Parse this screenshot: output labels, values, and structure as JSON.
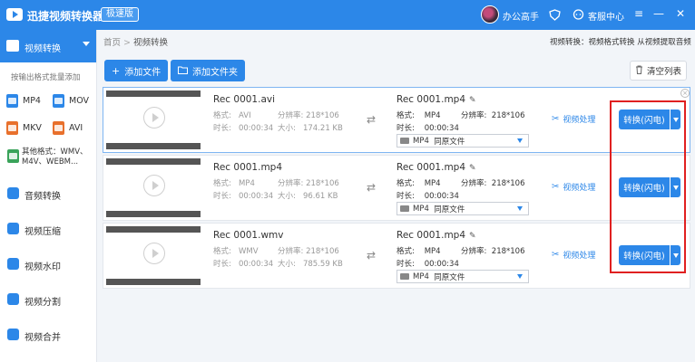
{
  "titlebar": {
    "app_name": "迅捷视频转换器",
    "badge": "极速版",
    "user_name": "办公高手",
    "help": "客服中心",
    "window_controls": {
      "menu": "≡",
      "minimize": "—",
      "close": "✕"
    }
  },
  "sidebar": {
    "active": {
      "label": "视频转换",
      "icon": "video-convert-icon"
    },
    "hint": "按输出格式批量添加",
    "formats": [
      {
        "label": "MP4",
        "color": "#2c87e8"
      },
      {
        "label": "MOV",
        "color": "#2c87e8"
      },
      {
        "label": "MKV",
        "color": "#e8702c"
      },
      {
        "label": "AVI",
        "color": "#e8702c"
      }
    ],
    "other_formats": [
      "其他格式：WMV、",
      "M4V、WEBM..."
    ],
    "items": [
      {
        "label": "音频转换",
        "icon": "audio-convert-icon"
      },
      {
        "label": "视频压缩",
        "icon": "video-compress-icon"
      },
      {
        "label": "视频水印",
        "icon": "video-watermark-icon"
      },
      {
        "label": "视频分割",
        "icon": "video-split-icon"
      },
      {
        "label": "视频合并",
        "icon": "video-merge-icon"
      }
    ]
  },
  "breadcrumb": {
    "home": "首页",
    "sep": ">",
    "current": "视频转换"
  },
  "top_info": "视频转换：视频格式转换 从视频提取音频",
  "toolbar": {
    "add_file": "添加文件",
    "add_folder": "添加文件夹",
    "clear_list": "清空列表"
  },
  "labels": {
    "format": "格式:",
    "resolution": "分辨率:",
    "duration": "时长:",
    "size": "大小:",
    "video_process": "视频处理",
    "convert": "转换(闪电)",
    "same_as_source": "同原文件"
  },
  "files": [
    {
      "src_name": "Rec 0001.avi",
      "src_format": "AVI",
      "src_resolution": "218*106",
      "src_duration": "00:00:34",
      "src_size": "174.21 KB",
      "out_name": "Rec 0001.mp4",
      "out_format": "MP4",
      "out_resolution": "218*106",
      "out_duration": "00:00:34",
      "out_select": "MP4"
    },
    {
      "src_name": "Rec 0001.mp4",
      "src_format": "MP4",
      "src_resolution": "218*106",
      "src_duration": "00:00:34",
      "src_size": "96.61 KB",
      "out_name": "Rec 0001.mp4",
      "out_format": "MP4",
      "out_resolution": "218*106",
      "out_duration": "00:00:34",
      "out_select": "MP4"
    },
    {
      "src_name": "Rec 0001.wmv",
      "src_format": "WMV",
      "src_resolution": "218*106",
      "src_duration": "00:00:34",
      "src_size": "785.59 KB",
      "out_name": "Rec 0001.mp4",
      "out_format": "MP4",
      "out_resolution": "218*106",
      "out_duration": "00:00:34",
      "out_select": "MP4"
    }
  ],
  "colors": {
    "accent": "#2c87e8",
    "highlight": "#e02020"
  }
}
